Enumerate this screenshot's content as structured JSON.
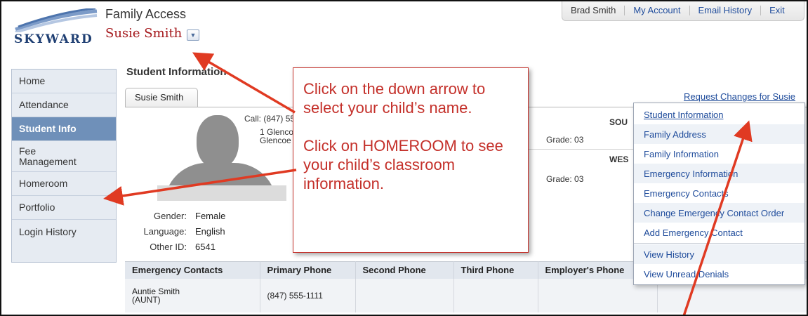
{
  "header": {
    "logo_text": "SKYWARD",
    "app_title": "Family Access",
    "student_name": "Susie Smith",
    "top_user": "Brad Smith",
    "top_links": [
      "My Account",
      "Email History",
      "Exit"
    ]
  },
  "sidebar": {
    "items": [
      {
        "label": "Home"
      },
      {
        "label": "Attendance"
      },
      {
        "label": "Student Info",
        "active": true
      },
      {
        "label": "Fee Management"
      },
      {
        "label": "Homeroom"
      },
      {
        "label": "Portfolio"
      },
      {
        "label": "Login History"
      }
    ]
  },
  "main": {
    "section_title": "Student Information",
    "tab_label": "Susie Smith",
    "request_link": "Request Changes for Susie",
    "call_label": "Call:",
    "call_value": "(847) 55",
    "address_line1": "1 Glenco",
    "address_line2": "Glencoe",
    "schools": [
      {
        "name": "SOU",
        "grade_label": "Grade:",
        "grade_value": "03"
      },
      {
        "name": "WES",
        "grade_label": "Grade:",
        "grade_value": "03"
      }
    ],
    "demographics": [
      {
        "label": "Gender:",
        "value": "Female"
      },
      {
        "label": "Language:",
        "value": "English"
      },
      {
        "label": "Other ID:",
        "value": "6541"
      }
    ]
  },
  "contacts_table": {
    "headers": [
      "Emergency Contacts",
      "Primary Phone",
      "Second Phone",
      "Third Phone",
      "Employer's Phone"
    ],
    "rows": [
      {
        "name": "Auntie Smith",
        "relation": "(AUNT)",
        "primary": "(847) 555-1111",
        "second": "",
        "third": "",
        "employer": ""
      }
    ]
  },
  "menu": {
    "items": [
      "Student Information",
      "Family Address",
      "Family Information",
      "Emergency Information",
      "Emergency Contacts",
      "Change Emergency Contact Order",
      "Add Emergency Contact",
      "View History",
      "View Unread Denials"
    ]
  },
  "callout": {
    "line1": "Click on the down arrow to select your child’s name.",
    "line2": "Click on HOMEROOM to see your child’s classroom information."
  },
  "colors": {
    "annotation_red": "#c4302a",
    "link_blue": "#1e4b9b",
    "sidebar_active": "#6f90b9",
    "student_name_red": "#a4161a"
  }
}
